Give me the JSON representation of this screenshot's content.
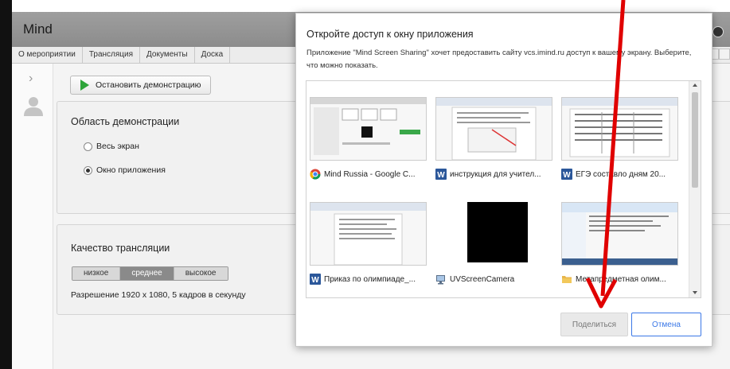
{
  "app": {
    "title": "Mind"
  },
  "tabs": [
    "О мероприятии",
    "Трансляция",
    "Документы",
    "Доска"
  ],
  "demo": {
    "stop_button": "Остановить демонстрацию",
    "area_title": "Область демонстрации",
    "options": [
      {
        "label": "Весь экран",
        "selected": false
      },
      {
        "label": "Окно приложения",
        "selected": true
      }
    ]
  },
  "quality": {
    "title": "Качество трансляции",
    "levels": [
      {
        "label": "низкое",
        "selected": false
      },
      {
        "label": "среднее",
        "selected": true
      },
      {
        "label": "высокое",
        "selected": false
      }
    ],
    "resolution": "Разрешение 1920 x 1080, 5 кадров в секунду"
  },
  "dialog": {
    "title": "Откройте доступ к окну приложения",
    "description": "Приложение \"Mind Screen Sharing\" хочет предоставить сайту vcs.imind.ru доступ к вашему экрану. Выберите, что можно показать.",
    "items": [
      {
        "label": "Mind Russia - Google C...",
        "icon": "chrome-icon"
      },
      {
        "label": "инструкция для учител...",
        "icon": "word-icon"
      },
      {
        "label": "ЕГЭ составло дням  20...",
        "icon": "word-icon"
      },
      {
        "label": "Приказ по олимпиаде_...",
        "icon": "word-icon"
      },
      {
        "label": "UVScreenCamera",
        "icon": "camera-icon"
      },
      {
        "label": "Метапредметная олим...",
        "icon": "folder-icon"
      }
    ],
    "share_button": "Поделиться",
    "cancel_button": "Отмена"
  },
  "colors": {
    "accent": "#3b78e7",
    "play": "#2ea43a",
    "annotation": "#e00000"
  }
}
